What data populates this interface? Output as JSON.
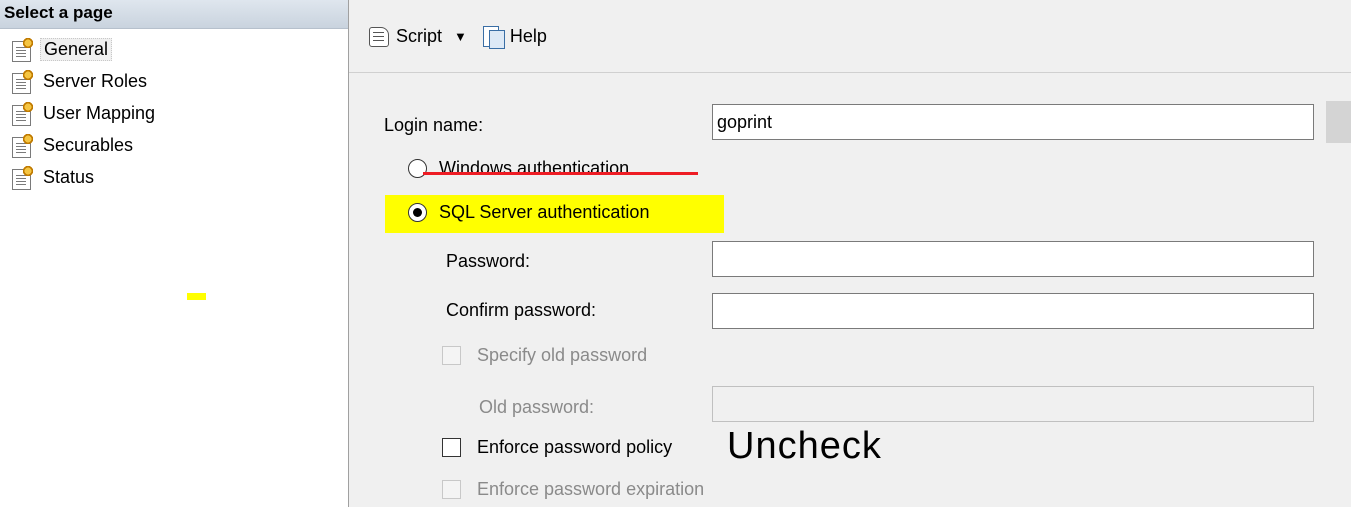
{
  "sidebar": {
    "header": "Select a page",
    "items": [
      {
        "label": "General",
        "selected": true,
        "icon": "page-settings-icon"
      },
      {
        "label": "Server Roles",
        "icon": "page-settings-icon"
      },
      {
        "label": "User Mapping",
        "icon": "page-settings-icon"
      },
      {
        "label": "Securables",
        "icon": "page-settings-icon"
      },
      {
        "label": "Status",
        "icon": "page-settings-icon"
      }
    ]
  },
  "toolbar": {
    "script_label": "Script",
    "script_icon": "script-icon",
    "dropdown_glyph": "▼",
    "help_label": "Help",
    "help_icon": "help-icon"
  },
  "form": {
    "login_name_label": "Login name:",
    "login_name_value": "goprint",
    "windows_auth_label": "Windows authentication",
    "windows_auth_selected": false,
    "sql_auth_label": "SQL Server authentication",
    "sql_auth_selected": true,
    "password_label": "Password:",
    "password_value": "",
    "confirm_password_label": "Confirm password:",
    "confirm_password_value": "",
    "specify_old_password_label": "Specify old password",
    "specify_old_password_checked": false,
    "old_password_label": "Old password:",
    "old_password_value": "",
    "enforce_policy_label": "Enforce password policy",
    "enforce_policy_checked": false,
    "enforce_expiration_label": "Enforce password expiration",
    "enforce_expiration_checked": false
  },
  "annotations": {
    "uncheck_note": "Uncheck",
    "highlight_color": "#ffff00",
    "strike_color": "#ee1c24"
  }
}
